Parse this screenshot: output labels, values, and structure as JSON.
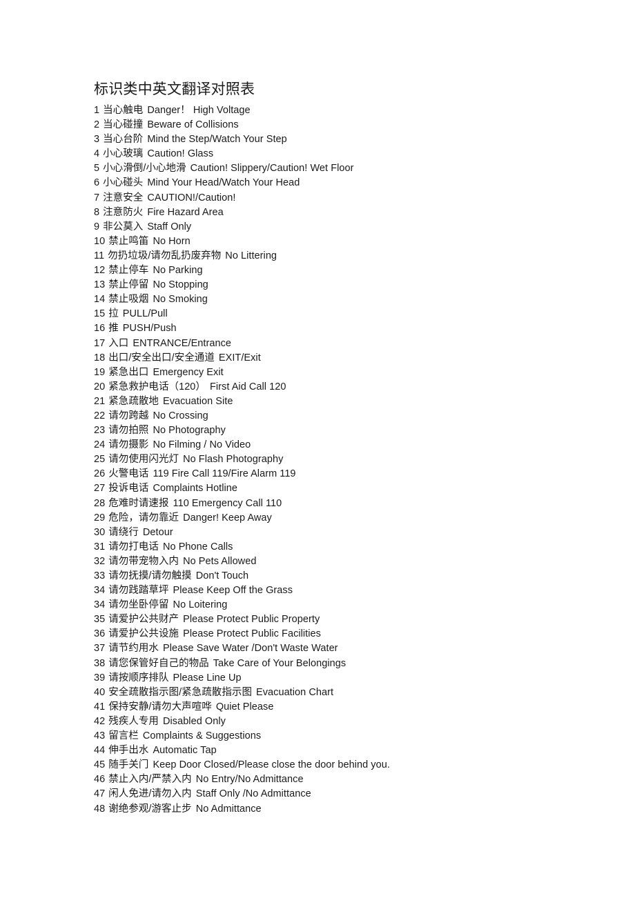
{
  "document": {
    "title": "标识类中英文翻译对照表",
    "entries": [
      {
        "num": "1",
        "zh": "当心触电",
        "en": "Danger！ High Voltage"
      },
      {
        "num": "2",
        "zh": "当心碰撞",
        "en": "Beware of Collisions"
      },
      {
        "num": "3",
        "zh": "当心台阶",
        "en": "Mind the Step/Watch Your Step"
      },
      {
        "num": "4",
        "zh": "小心玻璃",
        "en": "Caution! Glass"
      },
      {
        "num": "5",
        "zh": "小心滑倒/小心地滑",
        "en": "Caution! Slippery/Caution! Wet Floor"
      },
      {
        "num": "6",
        "zh": "小心碰头",
        "en": "Mind Your Head/Watch Your Head"
      },
      {
        "num": "7",
        "zh": "注意安全",
        "en": "CAUTION!/Caution!"
      },
      {
        "num": "8",
        "zh": "注意防火",
        "en": "Fire Hazard Area"
      },
      {
        "num": "9",
        "zh": "非公莫入",
        "en": "Staff Only"
      },
      {
        "num": "10",
        "zh": "禁止鸣笛",
        "en": "No Horn"
      },
      {
        "num": "11",
        "zh": "勿扔垃圾/请勿乱扔废弃物",
        "en": "No Littering"
      },
      {
        "num": "12",
        "zh": "禁止停车",
        "en": "No Parking"
      },
      {
        "num": "13",
        "zh": "禁止停留",
        "en": "No Stopping"
      },
      {
        "num": "14",
        "zh": "禁止吸烟",
        "en": "No Smoking"
      },
      {
        "num": "15",
        "zh": "拉",
        "en": "PULL/Pull"
      },
      {
        "num": "16",
        "zh": "推",
        "en": "PUSH/Push"
      },
      {
        "num": "17",
        "zh": "入口",
        "en": "ENTRANCE/Entrance"
      },
      {
        "num": "18",
        "zh": "出口/安全出口/安全通道",
        "en": "EXIT/Exit"
      },
      {
        "num": "19",
        "zh": "紧急出口",
        "en": "Emergency Exit"
      },
      {
        "num": "20",
        "zh": "紧急救护电话（120）",
        "en": "First Aid Call 120"
      },
      {
        "num": "21",
        "zh": "紧急疏散地",
        "en": "Evacuation Site"
      },
      {
        "num": "22",
        "zh": "请勿跨越",
        "en": "No Crossing"
      },
      {
        "num": "23",
        "zh": "请勿拍照",
        "en": "No Photography"
      },
      {
        "num": "24",
        "zh": "请勿摄影",
        "en": "No Filming / No Video"
      },
      {
        "num": "25",
        "zh": "请勿使用闪光灯",
        "en": "No Flash Photography"
      },
      {
        "num": "26",
        "zh": "火警电话",
        "en": "119 Fire Call 119/Fire Alarm 119"
      },
      {
        "num": "27",
        "zh": "投诉电话",
        "en": "Complaints Hotline"
      },
      {
        "num": "28",
        "zh": "危难时请速报",
        "en": "110 Emergency Call 110"
      },
      {
        "num": "29",
        "zh": "危险，请勿靠近",
        "en": "Danger! Keep Away"
      },
      {
        "num": "30",
        "zh": "请绕行",
        "en": "Detour"
      },
      {
        "num": "31",
        "zh": "请勿打电话",
        "en": "No Phone Calls"
      },
      {
        "num": "32",
        "zh": "请勿带宠物入内",
        "en": "No Pets Allowed"
      },
      {
        "num": "33",
        "zh": "请勿抚摸/请勿触摸",
        "en": "Don't Touch"
      },
      {
        "num": "34",
        "zh": "请勿践踏草坪",
        "en": "Please Keep Off the Grass"
      },
      {
        "num": "34",
        "zh": "请勿坐卧停留",
        "en": "No Loitering"
      },
      {
        "num": "35",
        "zh": "请爱护公共财产",
        "en": "Please Protect Public Property"
      },
      {
        "num": "36",
        "zh": "请爱护公共设施",
        "en": "Please Protect Public Facilities"
      },
      {
        "num": "37",
        "zh": "请节约用水",
        "en": "Please Save Water /Don't Waste Water"
      },
      {
        "num": "38",
        "zh": "请您保管好自己的物品",
        "en": "Take Care of Your Belongings"
      },
      {
        "num": "39",
        "zh": "请按顺序排队",
        "en": "Please Line Up"
      },
      {
        "num": "40",
        "zh": "安全疏散指示图/紧急疏散指示图",
        "en": "Evacuation Chart"
      },
      {
        "num": "41",
        "zh": "保持安静/请勿大声喧哗",
        "en": "Quiet Please"
      },
      {
        "num": "42",
        "zh": "残疾人专用",
        "en": "Disabled Only"
      },
      {
        "num": "43",
        "zh": "留言栏",
        "en": "Complaints & Suggestions"
      },
      {
        "num": "44",
        "zh": "伸手出水",
        "en": "Automatic Tap"
      },
      {
        "num": "45",
        "zh": "随手关门",
        "en": "Keep Door Closed/Please close the door behind you."
      },
      {
        "num": "46",
        "zh": "禁止入内/严禁入内",
        "en": "No Entry/No Admittance"
      },
      {
        "num": "47",
        "zh": "闲人免进/请勿入内",
        "en": "Staff Only /No Admittance"
      },
      {
        "num": "48",
        "zh": "谢绝参观/游客止步",
        "en": "No Admittance"
      }
    ]
  }
}
